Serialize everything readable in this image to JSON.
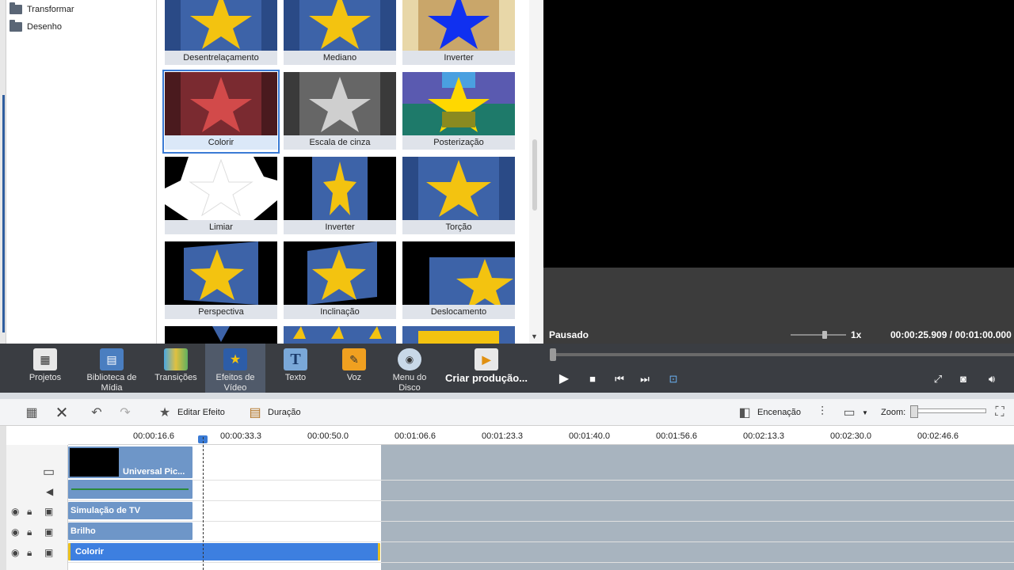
{
  "tree": {
    "items": [
      {
        "label": "Transformar"
      },
      {
        "label": "Desenho"
      }
    ]
  },
  "effects": {
    "tiles": [
      {
        "label": "Desentrelaçamento"
      },
      {
        "label": "Mediano"
      },
      {
        "label": "Inverter"
      },
      {
        "label": "Colorir"
      },
      {
        "label": "Escala de cinza"
      },
      {
        "label": "Posterização"
      },
      {
        "label": "Limiar"
      },
      {
        "label": "Inverter"
      },
      {
        "label": "Torção"
      },
      {
        "label": "Perspectiva"
      },
      {
        "label": "Inclinação"
      },
      {
        "label": "Deslocamento"
      }
    ]
  },
  "preview": {
    "status": "Pausado",
    "speed": "1x",
    "time": "00:00:25.909 / 00:01:00.000"
  },
  "toolbar": {
    "projetos": "Projetos",
    "biblioteca_line1": "Biblioteca de",
    "biblioteca_line2": "Mídia",
    "transicoes": "Transições",
    "efeitos_line1": "Efeitos de",
    "efeitos_line2": "Vídeo",
    "texto": "Texto",
    "voz": "Voz",
    "menu_line1": "Menu do",
    "menu_line2": "Disco",
    "criar": "Criar produção..."
  },
  "edit_toolbar": {
    "editar_efeito": "Editar Efeito",
    "duracao": "Duração",
    "encenacao": "Encenação",
    "zoom": "Zoom:"
  },
  "ruler": {
    "ticks": [
      "00:00:16.6",
      "00:00:33.3",
      "00:00:50.0",
      "00:01:06.6",
      "00:01:23.3",
      "00:01:40.0",
      "00:01:56.6",
      "00:02:13.3",
      "00:02:30.0",
      "00:02:46.6"
    ]
  },
  "tracks": {
    "video_clip": "Universal Pic...",
    "fx1": "Simulação de TV",
    "fx2": "Brilho",
    "fx3": "Colorir"
  },
  "colors": {
    "accent": "#3a7bd5",
    "toolbar_bg": "#3a3d42",
    "clip_fx": "#6e96c8",
    "clip_selected": "#3d7fe0"
  }
}
